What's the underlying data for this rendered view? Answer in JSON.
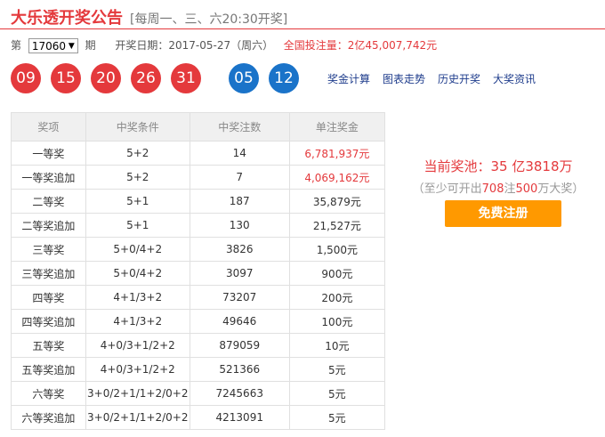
{
  "header": {
    "title": "大乐透开奖公告",
    "subtitle": "[每周一、三、六20:30开奖]"
  },
  "issue": {
    "prefix": "第",
    "selected": "17060",
    "suffix": "期",
    "date_label": "开奖日期：",
    "date": "2017-05-27（周六）",
    "total_label": "全国投注量：",
    "total": "2亿45,007,742元"
  },
  "balls": {
    "red": [
      "09",
      "15",
      "20",
      "26",
      "31"
    ],
    "blue": [
      "05",
      "12"
    ]
  },
  "links": [
    "奖金计算",
    "图表走势",
    "历史开奖",
    "大奖资讯"
  ],
  "table": {
    "headers": [
      "奖项",
      "中奖条件",
      "中奖注数",
      "单注奖金"
    ],
    "rows": [
      {
        "name": "一等奖",
        "cond": "5+2",
        "count": "14",
        "amount": "6,781,937元",
        "highlight": true
      },
      {
        "name": "一等奖追加",
        "cond": "5+2",
        "count": "7",
        "amount": "4,069,162元",
        "highlight": true
      },
      {
        "name": "二等奖",
        "cond": "5+1",
        "count": "187",
        "amount": "35,879元",
        "highlight": false
      },
      {
        "name": "二等奖追加",
        "cond": "5+1",
        "count": "130",
        "amount": "21,527元",
        "highlight": false
      },
      {
        "name": "三等奖",
        "cond": "5+0/4+2",
        "count": "3826",
        "amount": "1,500元",
        "highlight": false
      },
      {
        "name": "三等奖追加",
        "cond": "5+0/4+2",
        "count": "3097",
        "amount": "900元",
        "highlight": false
      },
      {
        "name": "四等奖",
        "cond": "4+1/3+2",
        "count": "73207",
        "amount": "200元",
        "highlight": false
      },
      {
        "name": "四等奖追加",
        "cond": "4+1/3+2",
        "count": "49646",
        "amount": "100元",
        "highlight": false
      },
      {
        "name": "五等奖",
        "cond": "4+0/3+1/2+2",
        "count": "879059",
        "amount": "10元",
        "highlight": false
      },
      {
        "name": "五等奖追加",
        "cond": "4+0/3+1/2+2",
        "count": "521366",
        "amount": "5元",
        "highlight": false
      },
      {
        "name": "六等奖",
        "cond": "3+0/2+1/1+2/0+2",
        "count": "7245663",
        "amount": "5元",
        "highlight": false
      },
      {
        "name": "六等奖追加",
        "cond": "3+0/2+1/1+2/0+2",
        "count": "4213091",
        "amount": "5元",
        "highlight": false
      }
    ]
  },
  "pool": {
    "label": "当前奖池：",
    "value": "35 亿3818万",
    "note_open": "（至少可开出",
    "note_count": "708",
    "note_mid": "注",
    "note_amount": "500",
    "note_close": "万大奖）"
  },
  "cta": {
    "label": "免费注册"
  },
  "colors": {
    "accent": "#e4393c",
    "blue_ball": "#1a73c9",
    "button": "#ff9900"
  }
}
